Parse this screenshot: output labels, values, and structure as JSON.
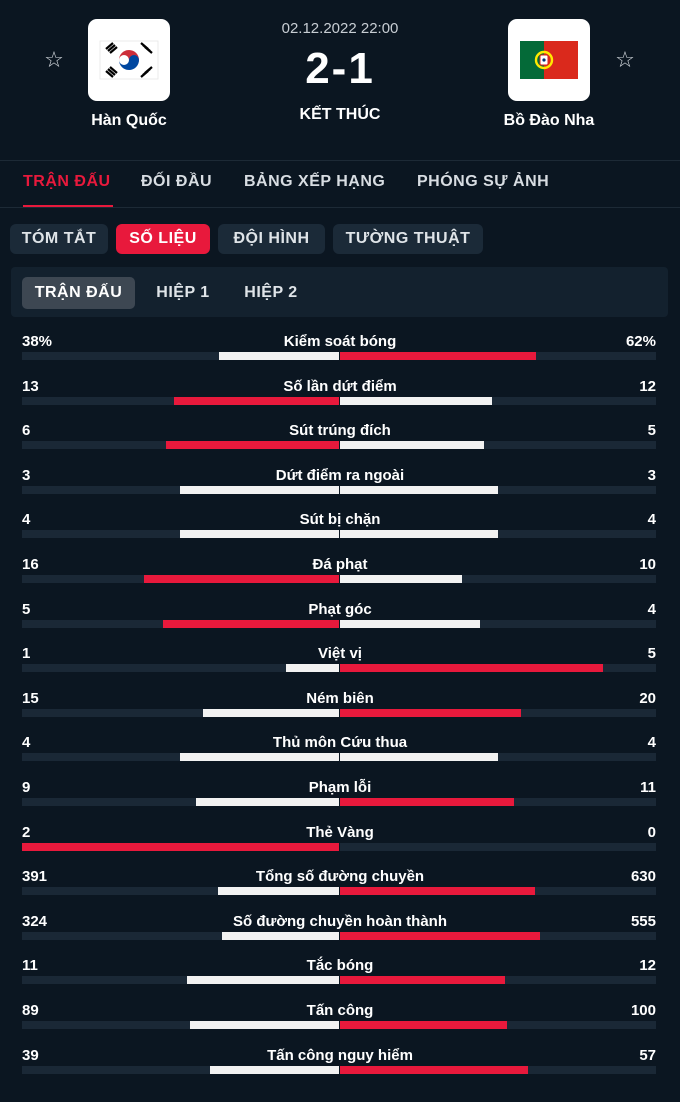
{
  "match": {
    "datetime": "02.12.2022 22:00",
    "score": "2-1",
    "status": "KẾT THÚC",
    "home": {
      "name": "Hàn Quốc",
      "flag_icon": "south-korea-flag-icon"
    },
    "away": {
      "name": "Bồ Đào Nha",
      "flag_icon": "portugal-flag-icon"
    }
  },
  "main_tabs": [
    "TRẬN ĐẤU",
    "ĐỐI ĐẦU",
    "BẢNG XẾP HẠNG",
    "PHÓNG SỰ ẢNH"
  ],
  "sub_tabs": [
    "TÓM TẮT",
    "SỐ LIỆU",
    "ĐỘI HÌNH",
    "TƯỜNG THUẬT"
  ],
  "periods": [
    "TRẬN ĐẤU",
    "HIỆP 1",
    "HIỆP 2"
  ],
  "colors": {
    "accent": "#e8193c",
    "background": "#0b1621",
    "bar_light": "#f2f2f2",
    "track": "#1a2836"
  },
  "stats": [
    {
      "label": "Kiểm soát bóng",
      "home": "38%",
      "away": "62%",
      "hv": 38,
      "av": 62
    },
    {
      "label": "Số lần dứt điểm",
      "home": "13",
      "away": "12",
      "hv": 13,
      "av": 12
    },
    {
      "label": "Sút trúng đích",
      "home": "6",
      "away": "5",
      "hv": 6,
      "av": 5
    },
    {
      "label": "Dứt điểm ra ngoài",
      "home": "3",
      "away": "3",
      "hv": 3,
      "av": 3
    },
    {
      "label": "Sút bị chặn",
      "home": "4",
      "away": "4",
      "hv": 4,
      "av": 4
    },
    {
      "label": "Đá phạt",
      "home": "16",
      "away": "10",
      "hv": 16,
      "av": 10
    },
    {
      "label": "Phạt góc",
      "home": "5",
      "away": "4",
      "hv": 5,
      "av": 4
    },
    {
      "label": "Việt vị",
      "home": "1",
      "away": "5",
      "hv": 1,
      "av": 5
    },
    {
      "label": "Ném biên",
      "home": "15",
      "away": "20",
      "hv": 15,
      "av": 20
    },
    {
      "label": "Thủ môn Cứu thua",
      "home": "4",
      "away": "4",
      "hv": 4,
      "av": 4
    },
    {
      "label": "Phạm lỗi",
      "home": "9",
      "away": "11",
      "hv": 9,
      "av": 11
    },
    {
      "label": "Thẻ Vàng",
      "home": "2",
      "away": "0",
      "hv": 2,
      "av": 0
    },
    {
      "label": "Tổng số đường chuyền",
      "home": "391",
      "away": "630",
      "hv": 391,
      "av": 630
    },
    {
      "label": "Số đường chuyền hoàn thành",
      "home": "324",
      "away": "555",
      "hv": 324,
      "av": 555
    },
    {
      "label": "Tắc bóng",
      "home": "11",
      "away": "12",
      "hv": 11,
      "av": 12
    },
    {
      "label": "Tấn công",
      "home": "89",
      "away": "100",
      "hv": 89,
      "av": 100
    },
    {
      "label": "Tấn công nguy hiểm",
      "home": "39",
      "away": "57",
      "hv": 39,
      "av": 57
    }
  ]
}
